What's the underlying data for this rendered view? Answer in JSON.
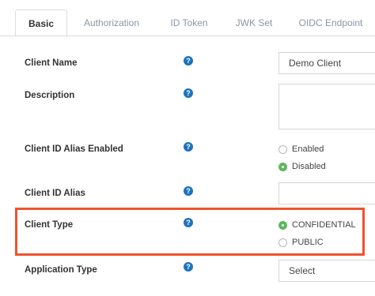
{
  "tabs": [
    {
      "label": "Basic"
    },
    {
      "label": "Authorization"
    },
    {
      "label": "ID Token"
    },
    {
      "label": "JWK Set"
    },
    {
      "label": "OIDC Endpoint"
    }
  ],
  "help_icon_glyph": "?",
  "fields": {
    "client_name": {
      "label": "Client Name",
      "value": "Demo Client"
    },
    "description": {
      "label": "Description",
      "value": ""
    },
    "client_id_alias_enabled": {
      "label": "Client ID Alias Enabled",
      "options": [
        {
          "label": "Enabled",
          "checked": false
        },
        {
          "label": "Disabled",
          "checked": true
        }
      ]
    },
    "client_id_alias": {
      "label": "Client ID Alias",
      "value": ""
    },
    "client_type": {
      "label": "Client Type",
      "options": [
        {
          "label": "CONFIDENTIAL",
          "checked": true
        },
        {
          "label": "PUBLIC",
          "checked": false
        }
      ]
    },
    "application_type": {
      "label": "Application Type",
      "value": "Select"
    }
  },
  "colors": {
    "accent_green": "#5cb85c",
    "help_blue": "#1e73be",
    "highlight_orange": "#f0522c"
  }
}
